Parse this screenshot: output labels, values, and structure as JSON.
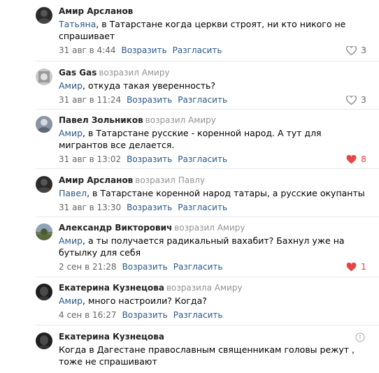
{
  "comments": [
    {
      "author": "Амир Арсланов",
      "replied": "",
      "mention": "Татьяна",
      "text": ", в Татарстане когда церкви строят, ни кто никого не спрашивает",
      "date": "31 авг в 4:44",
      "reply": "Возразить",
      "disagree": "Разгласить",
      "likes": "3",
      "liked": false
    },
    {
      "author": "Gas Gas",
      "replied": "возразил Амиру",
      "mention": "Амир",
      "text": ", откуда такая уверенность?",
      "date": "31 авг в 11:24",
      "reply": "Возразить",
      "disagree": "Разгласить",
      "likes": "3",
      "liked": false
    },
    {
      "author": "Павел Зольников",
      "replied": "возразил Амиру",
      "mention": "Амир",
      "text": ", в Татарстане русские - коренной народ. А тут для мигрантов все делается.",
      "date": "31 авг в 13:02",
      "reply": "Возразить",
      "disagree": "Разгласить",
      "likes": "8",
      "liked": true
    },
    {
      "author": "Амир Арсланов",
      "replied": "возразил Павлу",
      "mention": "Павел",
      "text": ", в Татарстане коренной народ татары, а русские окупанты",
      "date": "31 авг в 13:30",
      "reply": "Возразить",
      "disagree": "Разгласить",
      "likes": "",
      "liked": false
    },
    {
      "author": "Александр Викторович",
      "replied": "возразил Амиру",
      "mention": "Амир",
      "text": ", а ты получается радикальный вахабит? Бахнул уже на бутылку для себя",
      "date": "2 сен в 21:28",
      "reply": "Возразить",
      "disagree": "Разгласить",
      "likes": "1",
      "liked": true
    },
    {
      "author": "Екатерина Кузнецова",
      "replied": "возразила Амиру",
      "mention": "Амир",
      "text": ", много настроили? Когда?",
      "date": "4 сен в 16:27",
      "reply": "Возразить",
      "disagree": "Разгласить",
      "likes": "",
      "liked": false
    },
    {
      "author": "Екатерина Кузнецова",
      "replied": "",
      "mention": "",
      "text": "Когда в Дагестане православным священникам головы режут , тоже не спрашивают",
      "date": "",
      "reply": "",
      "disagree": "",
      "likes": "",
      "liked": false
    }
  ],
  "icons": {
    "heart_empty": "heart-outline-icon",
    "heart_full": "heart-filled-icon",
    "warning": "info-circle-icon"
  },
  "colors": {
    "link": "#2a5885",
    "like_active": "#e64646",
    "meta": "#656565"
  }
}
